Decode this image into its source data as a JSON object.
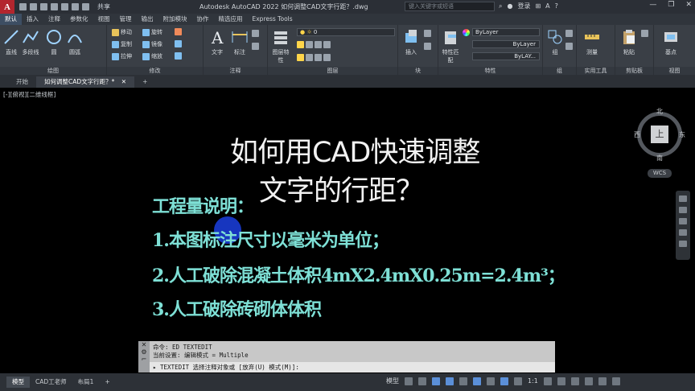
{
  "titlebar": {
    "logo": "A",
    "share": "共享",
    "title": "Autodesk AutoCAD 2022    如何调整CAD文字行距？.dwg",
    "search_placeholder": "键入关键字或短语",
    "login": "登录"
  },
  "ribbon_tabs": [
    "默认",
    "插入",
    "注释",
    "参数化",
    "视图",
    "管理",
    "输出",
    "附加模块",
    "协作",
    "精选应用",
    "Express Tools"
  ],
  "ribbon": {
    "draw": {
      "title": "绘图",
      "line": "直线",
      "polyline": "多段线",
      "circle": "圆",
      "arc": "圆弧"
    },
    "modify": {
      "title": "修改",
      "move": "移动",
      "rotate": "旋转",
      "copy": "复制",
      "mirror": "镜像",
      "stretch": "拉伸",
      "scale": "缩放"
    },
    "annotation": {
      "title": "注释",
      "text": "文字",
      "dimension": "标注"
    },
    "layers": {
      "title": "图层",
      "layer_props": "图层特性",
      "layer_value": "0"
    },
    "block": {
      "title": "块",
      "insert": "插入"
    },
    "properties": {
      "title": "特性",
      "match": "特性匹配",
      "color": "ByLayer",
      "linetype": "ByLayer",
      "lineweight": "ByLAY..."
    },
    "groups": {
      "title": "组",
      "group": "组"
    },
    "utilities": {
      "title": "实用工具",
      "measure": "测量"
    },
    "clipboard": {
      "title": "剪贴板",
      "paste": "粘贴"
    },
    "view": {
      "title": "视图",
      "base": "基点"
    }
  },
  "doc_tabs": {
    "start": "开始",
    "current": "如何调整CAD文字行距？*"
  },
  "drawing": {
    "view_label": "[-][俯视][二维线框]",
    "heading1": "如何用CAD快速调整",
    "heading2": "文字的行距？",
    "lines": [
      "工程量说明：",
      "1.本图标注尺寸以毫米为单位；",
      "2.人工破除混凝土体积4mX2.4mX0.25m=2.4m³；",
      "3.人工破除砖砌体体积"
    ]
  },
  "viewcube": {
    "north": "北",
    "south": "南",
    "east": "东",
    "west": "西",
    "top": "上",
    "wcs": "WCS"
  },
  "command": {
    "line1": "命令: ED TEXTEDIT",
    "line2": "当前设置: 编辑模式 = Multiple",
    "prompt": "TEXTEDIT 选择注释对象或 [放弃(U) 模式(M)]:"
  },
  "status": {
    "tabs": [
      "模型",
      "CAD工老师",
      "布局1"
    ],
    "model": "模型",
    "scale": "1:1"
  }
}
